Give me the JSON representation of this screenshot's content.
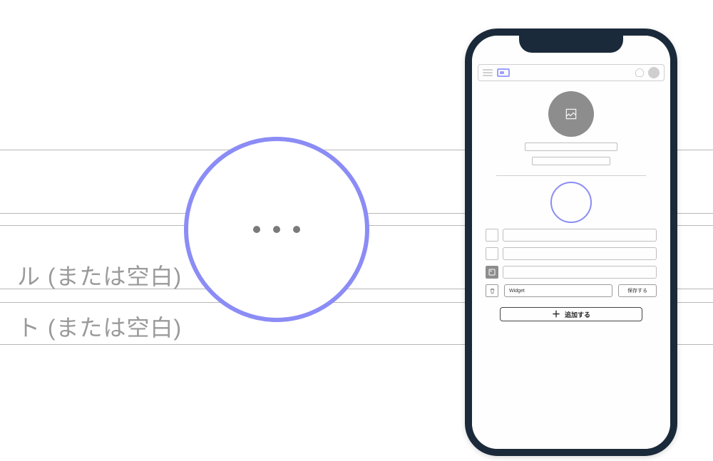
{
  "background": {
    "row1_text": "ル (または空白)",
    "row2_text": "ト (または空白)"
  },
  "loader": {
    "color": "#8b8cf5"
  },
  "phone": {
    "header": {
      "menu_name": "menu",
      "bell_name": "notifications",
      "avatar_name": "user-avatar"
    },
    "profile": {
      "avatar_icon": "image-icon"
    },
    "buttons": {
      "tag_label": "Widget",
      "save_label": "保存する",
      "add_label": "追加する"
    }
  }
}
